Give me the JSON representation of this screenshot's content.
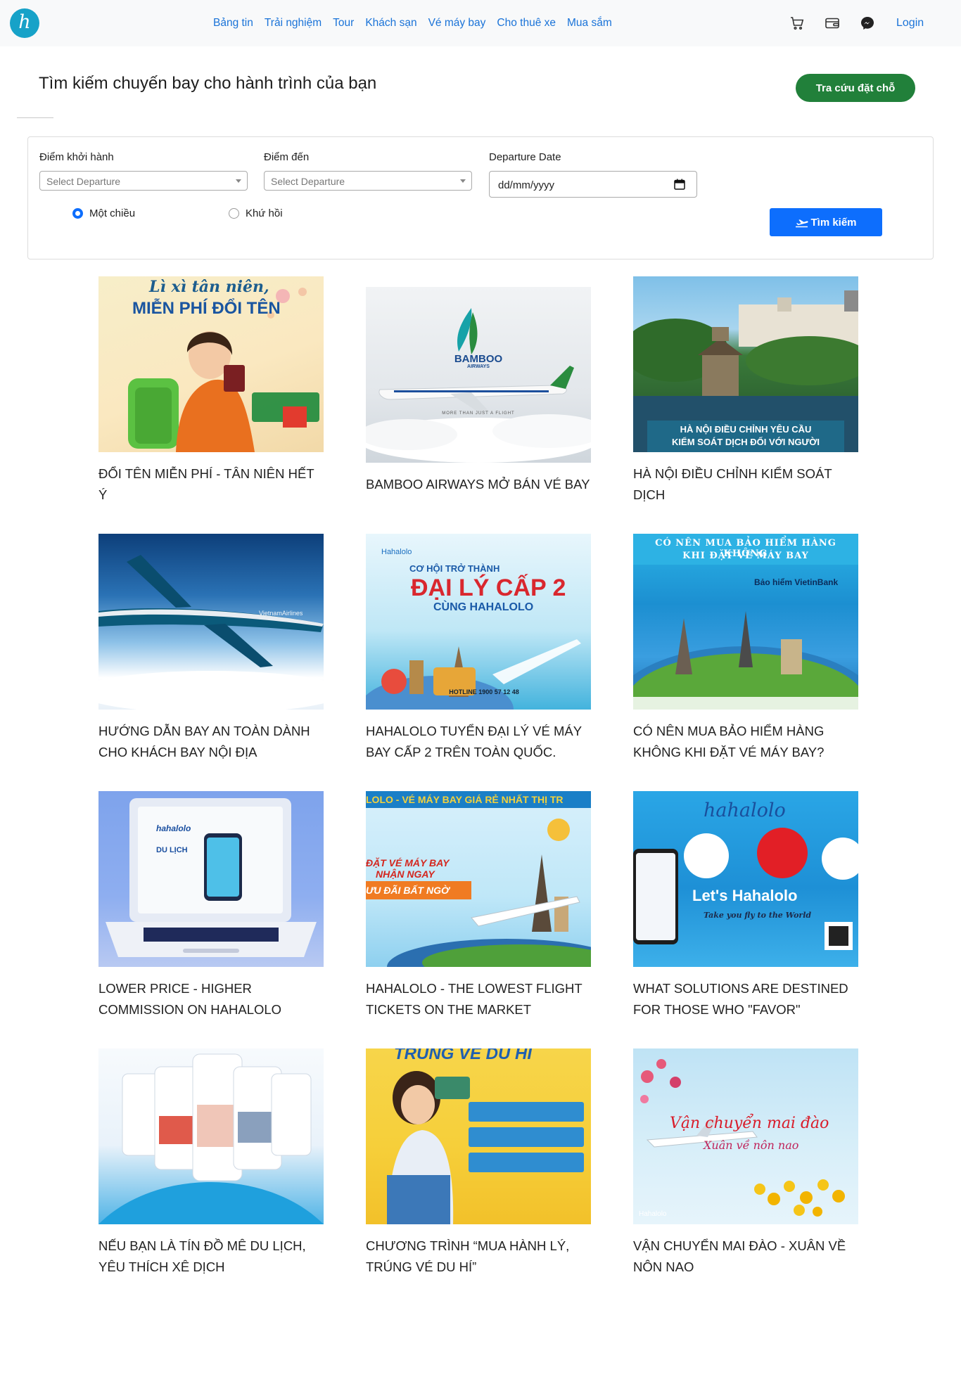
{
  "header": {
    "logo": "h",
    "nav": [
      "Bảng tin",
      "Trải nghiệm",
      "Tour",
      "Khách sạn",
      "Vé máy bay",
      "Cho thuê xe",
      "Mua sắm"
    ],
    "login": "Login"
  },
  "page": {
    "title": "Tìm kiếm chuyến bay cho hành trình của bạn",
    "lookup_button": "Tra cứu đặt chỗ"
  },
  "search": {
    "departure_label": "Điểm khởi hành",
    "departure_placeholder": "Select Departure",
    "arrival_label": "Điểm đến",
    "arrival_placeholder": "Select Departure",
    "date_label": "Departure Date",
    "date_value": "dd/mm/yyyy",
    "one_way": "Một chiều",
    "round_trip": "Khứ hồi",
    "search_button": "Tìm kiếm"
  },
  "articles": [
    {
      "title": "ĐỔI TÊN MIỄN PHÍ - TÂN NIÊN HẾT Ý",
      "banner": [
        "Lì xì tân niên,",
        "MIỄN PHÍ ĐỔI TÊN"
      ]
    },
    {
      "title": "BAMBOO AIRWAYS MỞ BÁN VÉ BAY",
      "banner": [
        "BAMBOO",
        "AIRWAYS",
        "MORE THAN JUST A FLIGHT"
      ]
    },
    {
      "title": "HÀ NỘI ĐIỀU CHỈNH KIỂM SOÁT DỊCH",
      "banner": [
        "HÀ NỘI ĐIỀU CHỈNH YÊU CẦU",
        "KIỂM SOÁT DỊCH ĐỐI VỚI NGƯỜI"
      ]
    },
    {
      "title": "HƯỚNG DẪN BAY AN TOÀN DÀNH CHO KHÁCH BAY NỘI ĐỊA",
      "banner": [
        "VietnamAirlines"
      ]
    },
    {
      "title": "HAHALOLO TUYỂN ĐẠI LÝ VÉ MÁY BAY CẤP 2 TRÊN TOÀN QUỐC.",
      "banner": [
        "Hahalolo",
        "CƠ HỘI TRỞ THÀNH",
        "ĐẠI LÝ CẤP 2",
        "CÙNG HAHALOLO",
        "HOTLINE 1900 57 12 48"
      ]
    },
    {
      "title": "CÓ NÊN MUA BẢO HIỂM HÀNG KHÔNG KHI ĐẶT VÉ MÁY BAY?",
      "banner": [
        "CÓ NÊN MUA BẢO HIỂM HÀNG KHÔNG",
        "KHI ĐẶT VÉ MÁY BAY",
        "Bảo hiểm VietinBank"
      ]
    },
    {
      "title": "LOWER PRICE - HIGHER COMMISSION ON HAHALOLO",
      "banner": [
        "hahalolo",
        "DU LỊCH"
      ]
    },
    {
      "title": "HAHALOLO - THE LOWEST FLIGHT TICKETS ON THE MARKET",
      "banner": [
        "LOLO - VÉ MÁY BAY GIÁ RẺ NHẤT THỊ TR",
        "ĐẶT VÉ MÁY BAY",
        "NHẬN NGAY",
        "ƯU ĐÃI BẤT NGỜ"
      ]
    },
    {
      "title": "WHAT SOLUTIONS ARE DESTINED FOR THOSE WHO \"FAVOR\"",
      "banner": [
        "hahalolo",
        "Let's Hahalolo",
        "Take you fly to the World"
      ]
    },
    {
      "title": "NẾU BẠN LÀ TÍN ĐỒ MÊ DU LỊCH, YÊU THÍCH XÊ DỊCH",
      "banner": []
    },
    {
      "title": "CHƯƠNG TRÌNH “MUA HÀNH LÝ, TRÚNG VÉ DU HÍ”",
      "banner": [
        "TRÚNG VÉ DU HÍ"
      ]
    },
    {
      "title": "VẬN CHUYỂN MAI ĐÀO - XUÂN VỀ NÔN NAO",
      "banner": [
        "Vận chuyển mai đào",
        "Xuân về nôn nao",
        "Hahalolo"
      ]
    }
  ],
  "colors": {
    "brand": "#17a2c8",
    "nav_link": "#1a73d8",
    "lookup_button": "#21803a",
    "search_button": "#0d6efd"
  }
}
